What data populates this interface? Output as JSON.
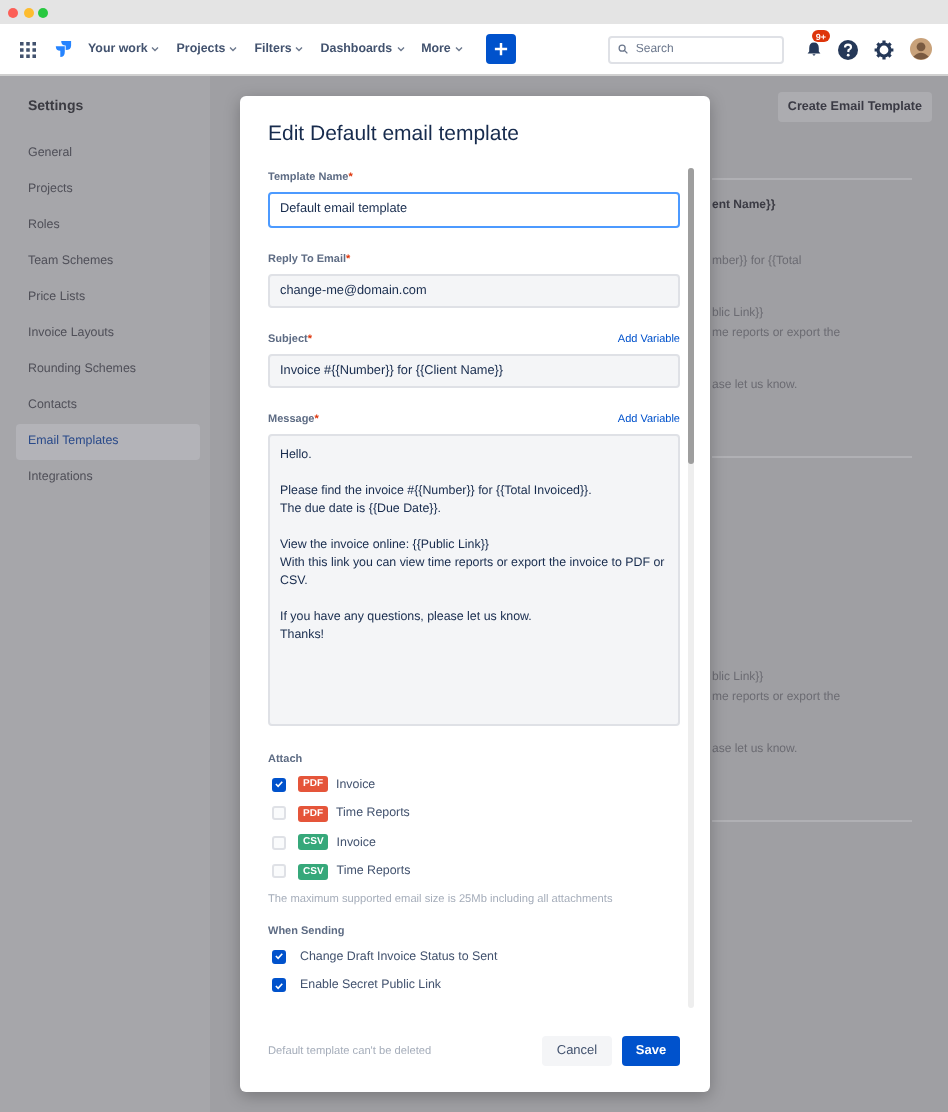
{
  "navbar": {
    "menus": [
      {
        "label": "Your work"
      },
      {
        "label": "Projects"
      },
      {
        "label": "Filters"
      },
      {
        "label": "Dashboards"
      },
      {
        "label": "More"
      }
    ],
    "search": {
      "placeholder": "Search"
    },
    "notifications_badge": "9+"
  },
  "sidebar": {
    "title": "Settings",
    "items": [
      {
        "label": "General",
        "selected": false
      },
      {
        "label": "Projects",
        "selected": false
      },
      {
        "label": "Roles",
        "selected": false
      },
      {
        "label": "Team Schemes",
        "selected": false
      },
      {
        "label": "Price Lists",
        "selected": false
      },
      {
        "label": "Invoice Layouts",
        "selected": false
      },
      {
        "label": "Rounding Schemes",
        "selected": false
      },
      {
        "label": "Contacts",
        "selected": false
      },
      {
        "label": "Email Templates",
        "selected": true
      },
      {
        "label": "Integrations",
        "selected": false
      }
    ]
  },
  "page": {
    "create_button": "Create Email Template",
    "background_blocks": [
      {
        "title": "ent Name}}",
        "paragraphs": [
          [
            "mber}} for {{Total"
          ],
          [
            "blic Link}}",
            "me reports or export the"
          ],
          [
            "ase let us know."
          ]
        ]
      },
      {
        "paragraphs": [
          [
            "blic Link}}",
            "me reports or export the"
          ],
          [
            "ase let us know."
          ]
        ]
      }
    ]
  },
  "dialog": {
    "title": "Edit Default email template",
    "fields": [
      {
        "label": "Template Name",
        "required_mark": "*",
        "value": "Default email template",
        "focused": true
      },
      {
        "label": "Reply To Email",
        "required_mark": "*",
        "value": "change-me@domain.com",
        "focused": false
      },
      {
        "label": "Subject",
        "required_mark": "*",
        "value": "Invoice #{{Number}} for {{Client Name}}",
        "focused": false,
        "add_variable": "Add Variable"
      }
    ],
    "message": {
      "label": "Message",
      "required_mark": "*",
      "add_variable": "Add Variable",
      "value": "Hello.\n\nPlease find the invoice #{{Number}} for {{Total Invoiced}}.\nThe due date is {{Due Date}}.\n\nView the invoice online: {{Public Link}}\nWith this link you can view time reports or export the invoice to PDF or CSV.\n\nIf you have any questions, please let us know.\nThanks!"
    },
    "attach": {
      "label": "Attach",
      "items": [
        {
          "format": "PDF",
          "color": "#e5553a",
          "label": "Invoice",
          "checked": true
        },
        {
          "format": "PDF",
          "color": "#e5553a",
          "label": "Time Reports",
          "checked": false
        },
        {
          "format": "CSV",
          "color": "#36a87a",
          "label": "Invoice",
          "checked": false
        },
        {
          "format": "CSV",
          "color": "#36a87a",
          "label": "Time Reports",
          "checked": false
        }
      ],
      "note": "The maximum supported email size is 25Mb including all attachments"
    },
    "when_sending": {
      "label": "When Sending",
      "items": [
        {
          "label": "Change Draft Invoice Status to Sent",
          "checked": true
        },
        {
          "label": "Enable Secret Public Link",
          "checked": true
        }
      ]
    },
    "footer_note": "Default template can't be deleted",
    "buttons": {
      "cancel": "Cancel",
      "save": "Save"
    }
  }
}
